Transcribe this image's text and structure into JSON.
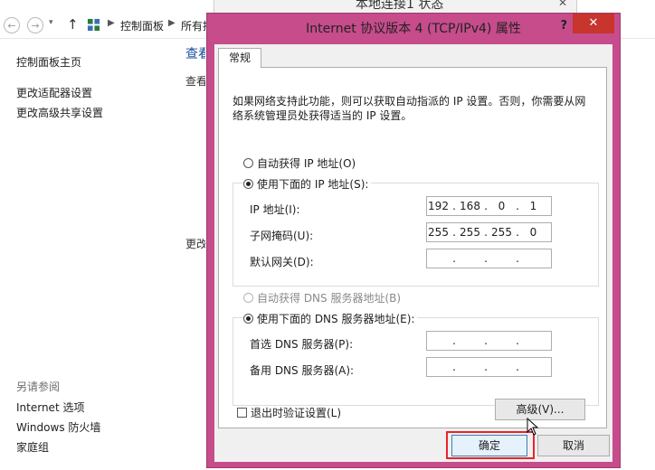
{
  "background_window": {
    "title_fragment": "本地连接1 状态",
    "breadcrumb": [
      "控制面板",
      "所有控"
    ],
    "sidebar": {
      "home_link": "控制面板主页",
      "links": [
        "更改适配器设置",
        "更改高级共享设置"
      ],
      "see_also_heading": "另请参阅",
      "see_also_links": [
        "Internet 选项",
        "Windows 防火墙",
        "家庭组"
      ]
    },
    "main_fragments": [
      "查看",
      "查看",
      "更改"
    ]
  },
  "dialog": {
    "title": "Internet 协议版本 4 (TCP/IPv4) 属性",
    "help_label": "?",
    "close_label": "✕",
    "tab_label": "常规",
    "description": "如果网络支持此功能，则可以获取自动指派的 IP 设置。否则，你需要从网络系统管理员处获得适当的 IP 设置。",
    "ip_section": {
      "auto_label": "自动获得 IP 地址(O)",
      "manual_label": "使用下面的 IP 地址(S):",
      "selected": "manual",
      "fields": [
        {
          "label": "IP 地址(I):",
          "octets": [
            "192",
            "168",
            "0",
            "1"
          ]
        },
        {
          "label": "子网掩码(U):",
          "octets": [
            "255",
            "255",
            "255",
            "0"
          ]
        },
        {
          "label": "默认网关(D):",
          "octets": [
            "",
            "",
            "",
            ""
          ]
        }
      ]
    },
    "dns_section": {
      "auto_label": "自动获得 DNS 服务器地址(B)",
      "manual_label": "使用下面的 DNS 服务器地址(E):",
      "selected": "manual",
      "fields": [
        {
          "label": "首选 DNS 服务器(P):",
          "octets": [
            "",
            "",
            "",
            ""
          ]
        },
        {
          "label": "备用 DNS 服务器(A):",
          "octets": [
            "",
            "",
            "",
            ""
          ]
        }
      ]
    },
    "validate_label": "退出时验证设置(L)",
    "advanced_label": "高级(V)...",
    "ok_label": "确定",
    "cancel_label": "取消"
  },
  "colors": {
    "dialog_frame": "#c64c8c",
    "close_button": "#c7352c",
    "highlight_box": "#e8242a"
  }
}
